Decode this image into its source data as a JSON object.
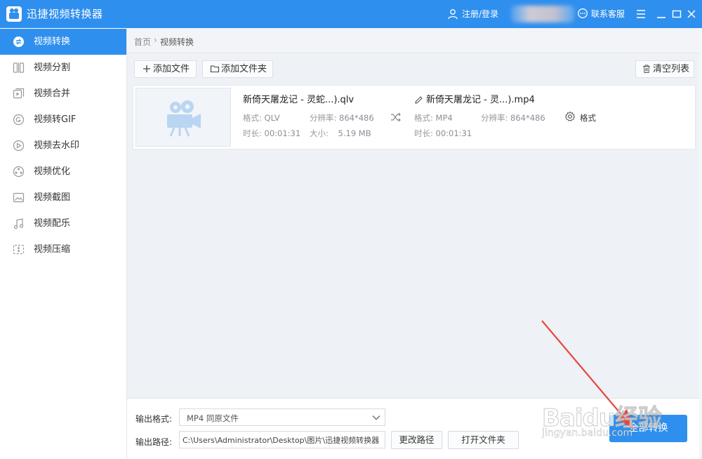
{
  "app": {
    "title": "迅捷视频转换器",
    "login": "注册/登录",
    "support": "联系客服",
    "accent": "#2f8fee"
  },
  "sidebar": {
    "items": [
      {
        "label": "视频转换",
        "icon": "convert-icon",
        "active": true
      },
      {
        "label": "视频分割",
        "icon": "split-icon",
        "active": false
      },
      {
        "label": "视频合并",
        "icon": "merge-icon",
        "active": false
      },
      {
        "label": "视频转GIF",
        "icon": "gif-icon",
        "active": false
      },
      {
        "label": "视频去水印",
        "icon": "watermark-remove-icon",
        "active": false
      },
      {
        "label": "视频优化",
        "icon": "optimize-icon",
        "active": false
      },
      {
        "label": "视频截图",
        "icon": "screenshot-icon",
        "active": false
      },
      {
        "label": "视频配乐",
        "icon": "music-icon",
        "active": false
      },
      {
        "label": "视频压缩",
        "icon": "compress-icon",
        "active": false
      }
    ]
  },
  "breadcrumb": {
    "home": "首页",
    "separator": "›",
    "current": "视频转换"
  },
  "toolbar": {
    "add_file": "添加文件",
    "add_folder": "添加文件夹",
    "clear_list": "清空列表"
  },
  "file": {
    "source": {
      "name": "新倚天屠龙记 - 灵蛇...).qlv",
      "format_label": "格式:",
      "format": "QLV",
      "resolution_label": "分辨率:",
      "resolution": "864*486",
      "duration_label": "时长:",
      "duration": "00:01:31",
      "size_label": "大小:",
      "size": "5.19 MB"
    },
    "target": {
      "name": "新倚天屠龙记 - 灵...).mp4",
      "format_label": "格式:",
      "format": "MP4",
      "resolution_label": "分辨率:",
      "resolution": "864*486",
      "duration_label": "时长:",
      "duration": "00:01:31"
    },
    "settings_label": "格式"
  },
  "output": {
    "format_label": "输出格式:",
    "format_value": "MP4   同原文件",
    "path_label": "输出路径:",
    "path_value": "C:\\Users\\Administrator\\Desktop\\图片\\迅捷视频转换器",
    "change_path": "更改路径",
    "open_folder": "打开文件夹",
    "convert_all": "全部转换"
  },
  "watermark": {
    "brand": "Baidu经验",
    "url": "jingyan.baidu.com"
  }
}
